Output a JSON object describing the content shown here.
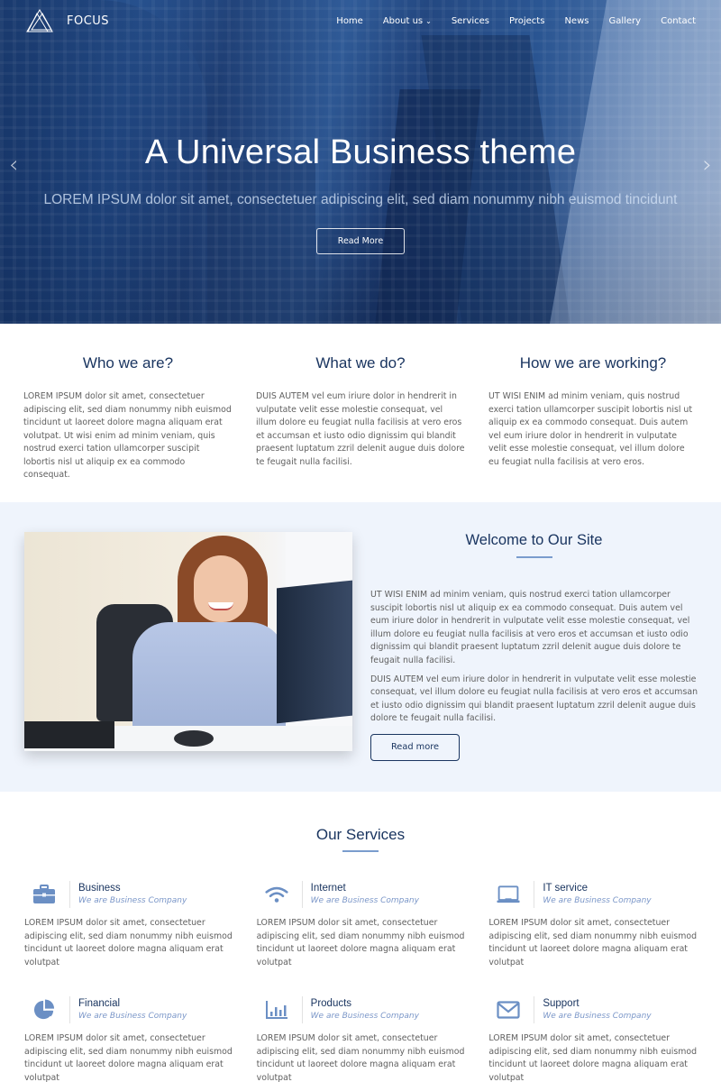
{
  "nav": {
    "logo_text": "FOCUS",
    "menu": [
      {
        "label": "Home",
        "has_dropdown": false
      },
      {
        "label": "About us",
        "has_dropdown": true
      },
      {
        "label": "Services",
        "has_dropdown": false
      },
      {
        "label": "Projects",
        "has_dropdown": false
      },
      {
        "label": "News",
        "has_dropdown": false
      },
      {
        "label": "Gallery",
        "has_dropdown": false
      },
      {
        "label": "Contact",
        "has_dropdown": false
      }
    ],
    "dropdown_glyph": "⌄"
  },
  "hero": {
    "title": "A Universal Business theme",
    "subtitle": "LOREM IPSUM dolor sit amet, consectetuer adipiscing elit, sed diam nonummy nibh euismod tincidunt",
    "button_label": "Read More",
    "prev_glyph": "‹",
    "next_glyph": "›"
  },
  "features": [
    {
      "title": "Who we are?",
      "text": "LOREM IPSUM dolor sit amet, consectetuer adipiscing elit, sed diam nonummy nibh euismod tincidunt ut laoreet dolore magna aliquam erat volutpat. Ut wisi enim ad minim veniam, quis nostrud exerci tation ullamcorper suscipit lobortis nisl ut aliquip ex ea commodo consequat."
    },
    {
      "title": "What we do?",
      "text": "DUIS AUTEM vel eum iriure dolor in hendrerit in vulputate velit esse molestie consequat, vel illum dolore eu feugiat nulla facilisis at vero eros et accumsan et iusto odio dignissim qui blandit praesent luptatum zzril delenit augue duis dolore te feugait nulla facilisi."
    },
    {
      "title": "How we are working?",
      "text": "UT WISI ENIM ad minim veniam, quis nostrud exerci tation ullamcorper suscipit lobortis nisl ut aliquip ex ea commodo consequat. Duis autem vel eum iriure dolor in hendrerit in vulputate velit esse molestie consequat, vel illum dolore eu feugiat nulla facilisis at vero eros."
    }
  ],
  "welcome": {
    "title": "Welcome to Our Site",
    "paragraph1": "UT WISI ENIM ad minim veniam, quis nostrud exerci tation ullamcorper suscipit lobortis nisl ut aliquip ex ea commodo consequat. Duis autem vel eum iriure dolor in hendrerit in vulputate velit esse molestie consequat, vel illum dolore eu feugiat nulla facilisis at vero eros et accumsan et iusto odio dignissim qui blandit praesent luptatum zzril delenit augue duis dolore te feugait nulla facilisi.",
    "paragraph2": "DUIS AUTEM vel eum iriure dolor in hendrerit in vulputate velit esse molestie consequat, vel illum dolore eu feugiat nulla facilisis at vero eros et accumsan et iusto odio dignissim qui blandit praesent luptatum zzril delenit augue duis dolore te feugait nulla facilisi.",
    "button_label": "Read more",
    "image_alt": "Smiling businesswoman at desk"
  },
  "services": {
    "title": "Our Services",
    "items": [
      {
        "icon": "briefcase-icon",
        "title": "Business",
        "subtitle": "We are Business Company",
        "text": "LOREM IPSUM dolor sit amet, consectetuer adipiscing elit, sed diam nonummy nibh euismod tincidunt ut laoreet dolore magna aliquam erat volutpat"
      },
      {
        "icon": "wifi-icon",
        "title": "Internet",
        "subtitle": "We are Business Company",
        "text": "LOREM IPSUM dolor sit amet, consectetuer adipiscing elit, sed diam nonummy nibh euismod tincidunt ut laoreet dolore magna aliquam erat volutpat"
      },
      {
        "icon": "laptop-icon",
        "title": "IT service",
        "subtitle": "We are Business Company",
        "text": "LOREM IPSUM dolor sit amet, consectetuer adipiscing elit, sed diam nonummy nibh euismod tincidunt ut laoreet dolore magna aliquam erat volutpat"
      },
      {
        "icon": "pie-chart-icon",
        "title": "Financial",
        "subtitle": "We are Business Company",
        "text": "LOREM IPSUM dolor sit amet, consectetuer adipiscing elit, sed diam nonummy nibh euismod tincidunt ut laoreet dolore magna aliquam erat volutpat"
      },
      {
        "icon": "bar-chart-icon",
        "title": "Products",
        "subtitle": "We are Business Company",
        "text": "LOREM IPSUM dolor sit amet, consectetuer adipiscing elit, sed diam nonummy nibh euismod tincidunt ut laoreet dolore magna aliquam erat volutpat"
      },
      {
        "icon": "envelope-icon",
        "title": "Support",
        "subtitle": "We are Business Company",
        "text": "LOREM IPSUM dolor sit amet, consectetuer adipiscing elit, sed diam nonummy nibh euismod tincidunt ut laoreet dolore magna aliquam erat volutpat"
      }
    ]
  },
  "colors": {
    "heading_navy": "#1a3560",
    "accent_blue": "#7a9ccd",
    "icon_blue": "#6b8fc4",
    "welcome_bg": "#eff4fc",
    "body_text": "#606060"
  }
}
